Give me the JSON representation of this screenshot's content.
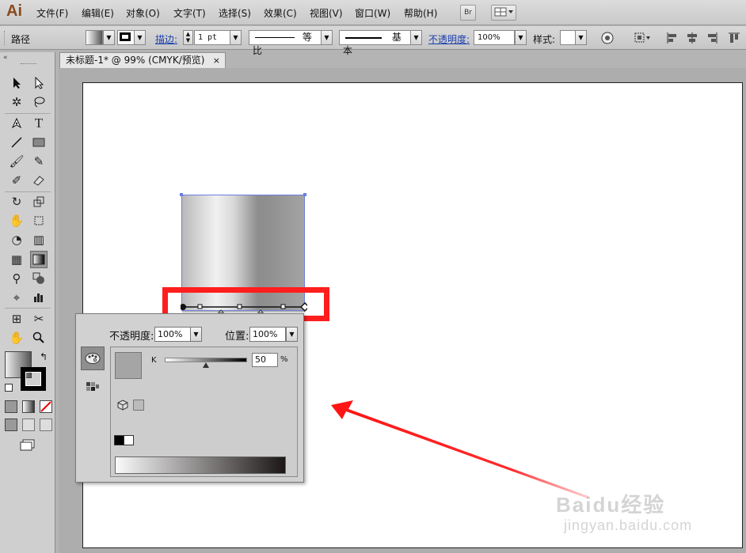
{
  "app": {
    "logo": "Ai"
  },
  "menu": {
    "items": [
      "文件(F)",
      "编辑(E)",
      "对象(O)",
      "文字(T)",
      "选择(S)",
      "效果(C)",
      "视图(V)",
      "窗口(W)",
      "帮助(H)"
    ],
    "bridge_label": "Br"
  },
  "control": {
    "path_label": "路径",
    "stroke_label": "描边:",
    "stroke_weight": "1 pt",
    "profile_label": "等比",
    "brush_label": "基本",
    "opacity_label": "不透明度:",
    "opacity_value": "100%",
    "style_label": "样式:"
  },
  "document": {
    "tab_title": "未标题-1* @ 99% (CMYK/预览)",
    "close_glyph": "×"
  },
  "gradient_panel": {
    "opacity_label": "不透明度:",
    "opacity_value": "100%",
    "position_label": "位置:",
    "position_value": "100%",
    "channel_label": "K",
    "channel_value": "50",
    "channel_unit": "%",
    "k_level": 0.5
  },
  "colors": {
    "highlight_red": "#ff1e1e",
    "selection_blue": "#6b7fe0",
    "logo_brown": "#8a4a1c"
  },
  "watermark": {
    "text": "Baidu经验",
    "sub": "jingyan.baidu.com"
  },
  "icons": [
    "selection-tool-icon",
    "direct-selection-icon",
    "magic-wand-icon",
    "lasso-icon",
    "pen-icon",
    "type-icon",
    "line-icon",
    "rectangle-icon",
    "paintbrush-icon",
    "pencil-icon",
    "blob-brush-icon",
    "eraser-icon",
    "rotate-icon",
    "scale-icon",
    "warp-icon",
    "free-transform-icon",
    "shape-builder-icon",
    "perspective-icon",
    "mesh-icon",
    "gradient-icon",
    "eyedropper-icon",
    "blend-icon",
    "symbol-sprayer-icon",
    "column-graph-icon",
    "artboard-icon",
    "slice-icon",
    "hand-icon",
    "zoom-icon"
  ]
}
